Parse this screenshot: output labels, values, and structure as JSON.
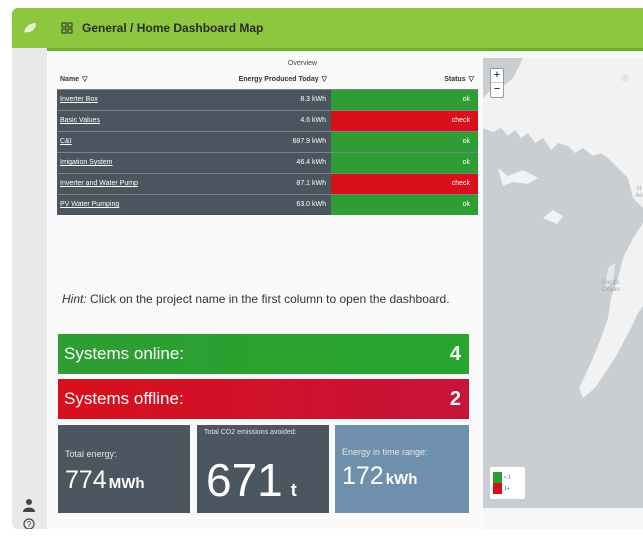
{
  "header": {
    "title": "General / Home Dashboard Map"
  },
  "table": {
    "caption": "Overview",
    "columns": [
      "Name",
      "Energy Produced Today",
      "Status"
    ],
    "rows": [
      {
        "name": "Inverter Box",
        "energy": "8.3 kWh",
        "status": "ok"
      },
      {
        "name": "Basic Values",
        "energy": "4.6 kWh",
        "status": "check"
      },
      {
        "name": "C&I",
        "energy": "687.9 kWh",
        "status": "ok"
      },
      {
        "name": "Irrigation System",
        "energy": "46.4 kWh",
        "status": "ok"
      },
      {
        "name": "Inverter and Water Pump",
        "energy": "87.1 kWh",
        "status": "check"
      },
      {
        "name": "PV Water Pumping",
        "energy": "63.0 kWh",
        "status": "ok"
      }
    ]
  },
  "hint": {
    "label": "Hint:",
    "text": " Click on the project name in the first column to open the dashboard."
  },
  "systems": {
    "online_label": "Systems online:",
    "online_count": "4",
    "offline_label": "Systems offline:",
    "offline_count": "2"
  },
  "tiles": {
    "energy_label": "Total energy:",
    "energy_value": "774",
    "energy_unit": "MWh",
    "co2_label": "Total CO2 emissions avoided:",
    "co2_value": "671",
    "co2_unit": "t",
    "range_label": "Energy in time range:",
    "range_value": "172",
    "range_unit": "kWh"
  },
  "map": {
    "zoom_in": "+",
    "zoom_out": "−",
    "ocean_label_1": "Pacific",
    "ocean_label_2": "Ocean",
    "edge_label_1": "N",
    "edge_label_2": "An",
    "legend": [
      {
        "label": "< 1",
        "color": "#2e9d33"
      },
      {
        "label": "1+",
        "color": "#d8101b"
      }
    ]
  },
  "colors": {
    "ok": "#2e9d33",
    "check": "#d8101b",
    "accent": "#8dc63f"
  }
}
